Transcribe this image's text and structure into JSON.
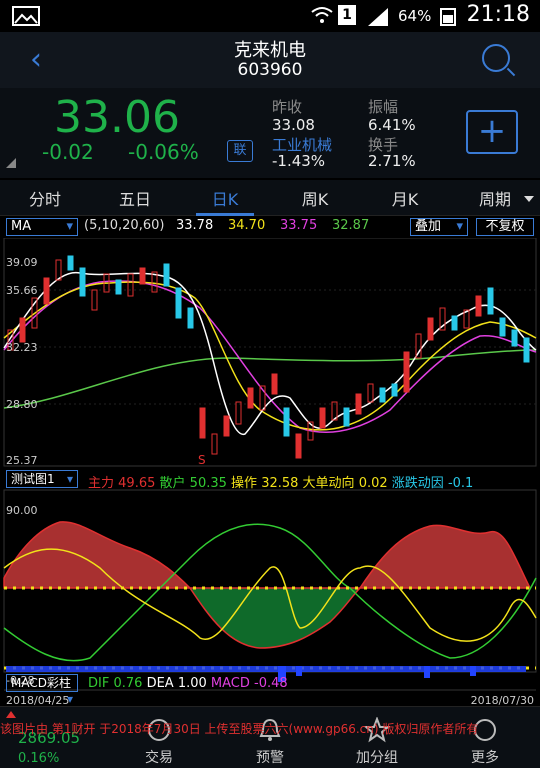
{
  "status": {
    "battery": "64%",
    "time": "21:18",
    "sim": "1"
  },
  "header": {
    "name": "克来机电",
    "code": "603960"
  },
  "quote": {
    "price": "33.06",
    "change": "-0.02",
    "change_pct": "-0.06%",
    "lian": "联",
    "prev_close_label": "昨收",
    "prev_close": "33.08",
    "amplitude_label": "振幅",
    "amplitude": "6.41%",
    "sector": "工业机械",
    "sector_change": "-1.43%",
    "turnover_label": "换手",
    "turnover": "2.71%",
    "color_down": "#1fb24a"
  },
  "tabs": [
    {
      "label": "分时"
    },
    {
      "label": "五日"
    },
    {
      "label": "日K"
    },
    {
      "label": "周K"
    },
    {
      "label": "月K"
    },
    {
      "label": "周期"
    }
  ],
  "main_chart": {
    "indicator": "MA",
    "params": "(5,10,20,60)",
    "ma5": "33.78",
    "ma10": "34.70",
    "ma20": "33.75",
    "ma60": "32.87",
    "overlay": "叠加",
    "adjust": "不复权",
    "y_ticks": [
      "39.09",
      "35.66",
      "32.23",
      "28.80",
      "25.37"
    ],
    "marker": "S",
    "colors": {
      "ma5": "#ffffff",
      "ma10": "#f2e21a",
      "ma20": "#e040e0",
      "ma60": "#5ac84a",
      "up": "#e03030",
      "down": "#28c8e8"
    }
  },
  "sub_chart": {
    "name": "测试图1",
    "zhuli_label": "主力",
    "zhuli": "49.65",
    "sanhu_label": "散户",
    "sanhu": "50.35",
    "caozuo_label": "操作",
    "caozuo": "32.58",
    "dadan_label": "大单动向",
    "dadan": "0.02",
    "zhangdie_label": "涨跌动因",
    "zhangdie": "-0.1",
    "y_top": "90.00",
    "y_bottom": "-0.28"
  },
  "macd": {
    "name": "MACD彩柱",
    "dif_label": "DIF",
    "dif": "0.76",
    "dea_label": "DEA",
    "dea": "1.00",
    "macd_label": "MACD",
    "macd": "-0.48"
  },
  "dates": {
    "start": "2018/04/25",
    "end": "2018/07/30"
  },
  "bottom": {
    "index_value": "2869.05",
    "index_change": "0.16%",
    "nav": [
      {
        "label": "交易"
      },
      {
        "label": "预警"
      },
      {
        "label": "加分组"
      },
      {
        "label": "更多"
      }
    ],
    "notice": "该图片由 第1财开 于2018年7月30日 上传至股票六六(www.gp66.cn) 版权归原作者所有"
  }
}
